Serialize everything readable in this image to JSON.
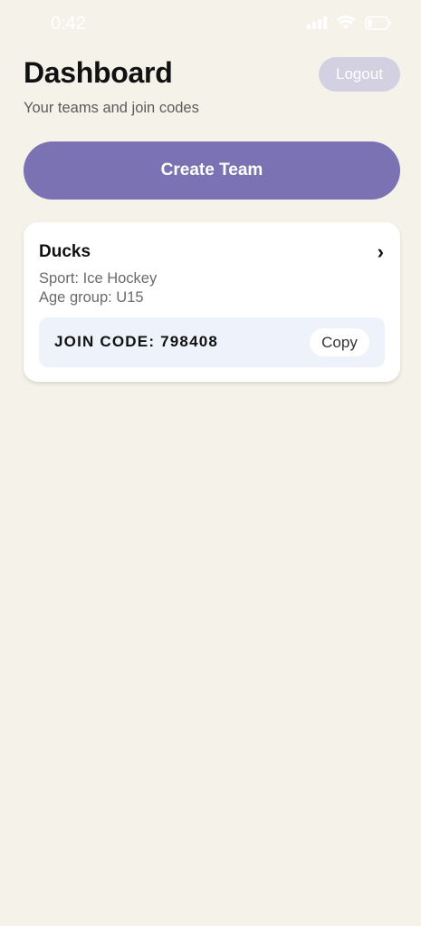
{
  "status_bar": {
    "time": "0:42",
    "icons": [
      "signal-icon",
      "wifi-icon",
      "battery-icon"
    ]
  },
  "header": {
    "title": "Dashboard",
    "subtitle": "Your teams and join codes",
    "logout_label": "Logout"
  },
  "actions": {
    "create_team_label": "Create Team"
  },
  "teams": [
    {
      "name": "Ducks",
      "sport": "Sport: Ice Hockey",
      "age_group": "Age group: U15",
      "join_code": "JOIN CODE: 798408",
      "copy_label": "Copy"
    }
  ],
  "colors": {
    "background": "#f5f2ea",
    "accent": "#7a72b2",
    "logout_bg": "#d3d0e1",
    "join_code_bg": "#eef3fb"
  }
}
